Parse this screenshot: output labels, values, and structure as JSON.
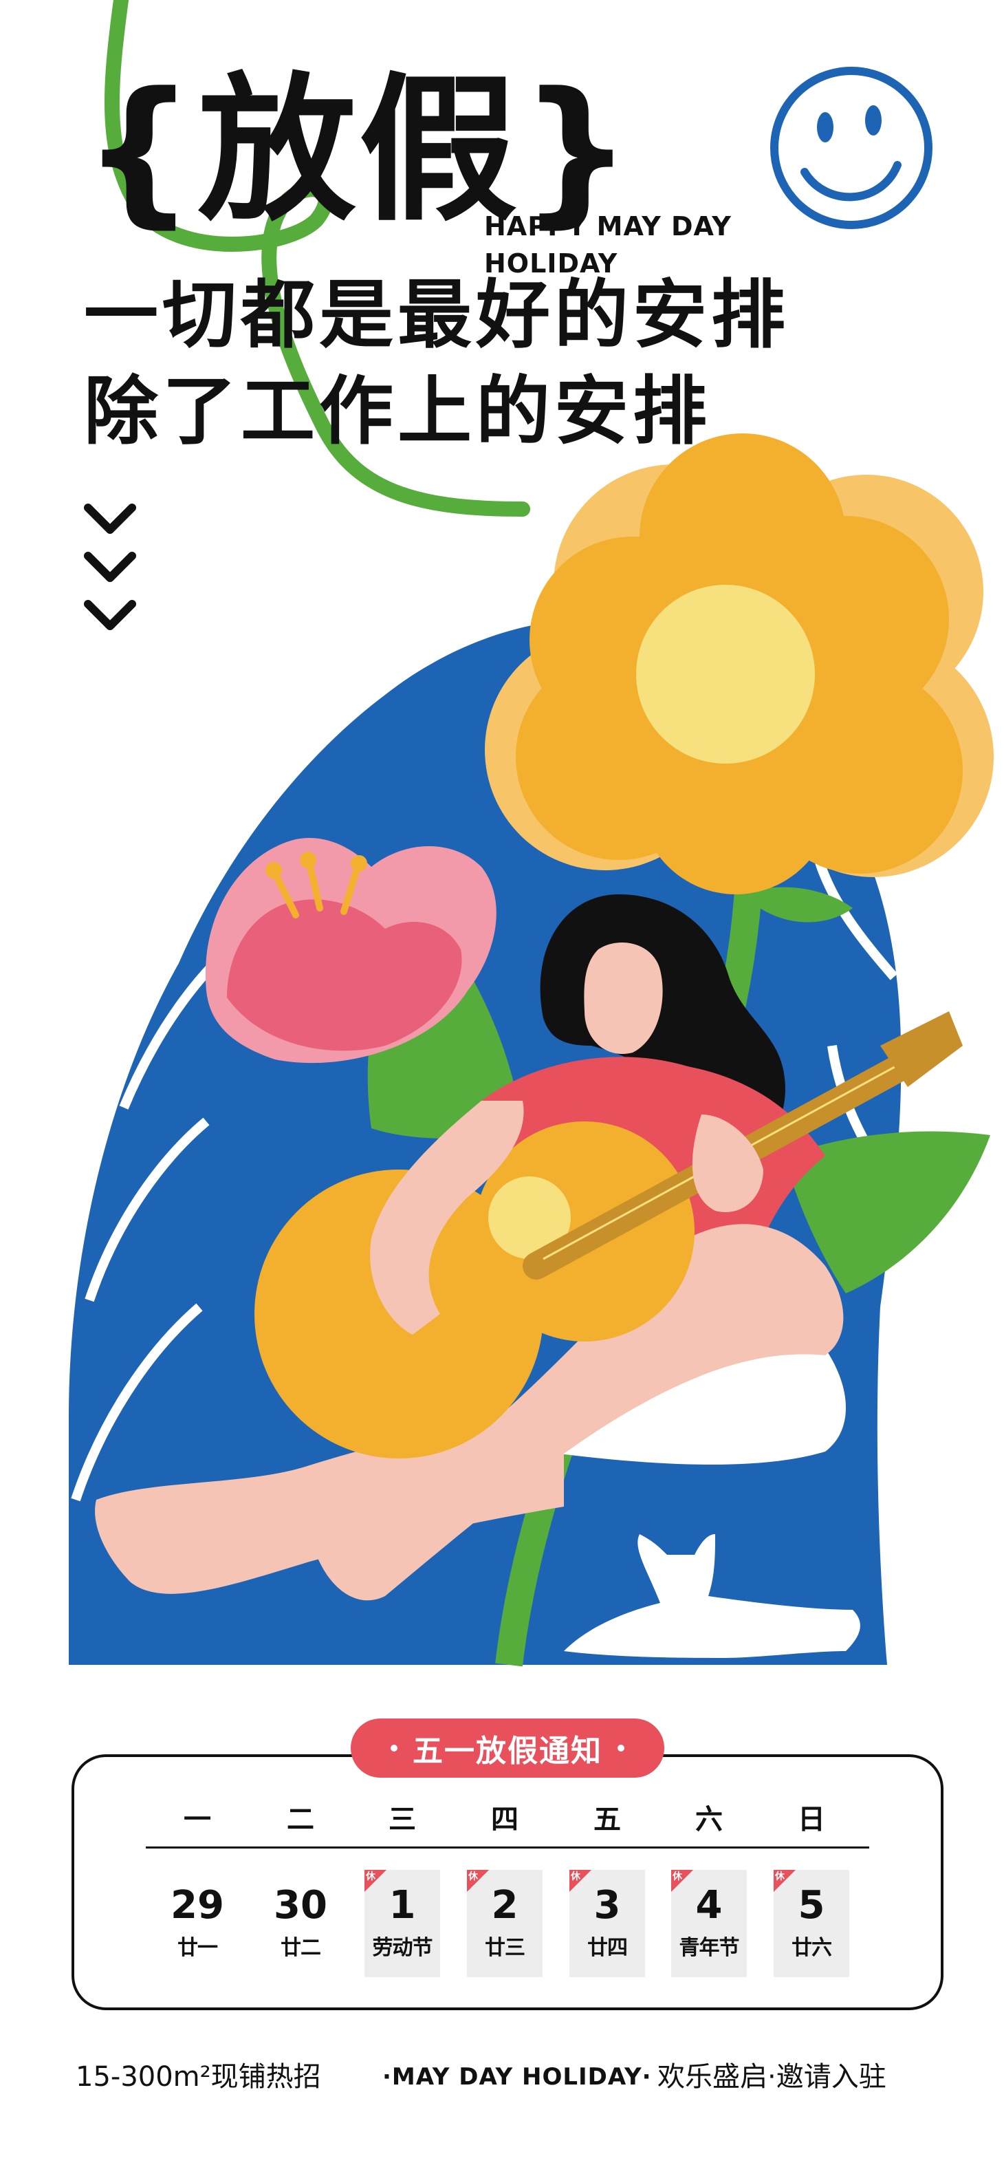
{
  "title": "{放假}",
  "subtitle_en_line1": "HAPPY MAY DAY",
  "subtitle_en_line2": "HOLIDAY",
  "slogan_line1": "一切都是最好的安排",
  "slogan_line2": "除了工作上的安排",
  "notice_label": "五一放假通知",
  "calendar": {
    "weekdays": [
      "一",
      "二",
      "三",
      "四",
      "五",
      "六",
      "日"
    ],
    "holiday_tag": "休",
    "days": [
      {
        "day": "29",
        "lunar": "廿一",
        "holiday": false
      },
      {
        "day": "30",
        "lunar": "廿二",
        "holiday": false
      },
      {
        "day": "1",
        "lunar": "劳动节",
        "holiday": true
      },
      {
        "day": "2",
        "lunar": "廿三",
        "holiday": true
      },
      {
        "day": "3",
        "lunar": "廿四",
        "holiday": true
      },
      {
        "day": "4",
        "lunar": "青年节",
        "holiday": true
      },
      {
        "day": "5",
        "lunar": "廿六",
        "holiday": true
      }
    ]
  },
  "footer": {
    "left": "15-300m²现铺热招",
    "middle": "·MAY DAY HOLIDAY·",
    "right": "欢乐盛启·邀请入驻"
  },
  "colors": {
    "blue": "#1e64b4",
    "yellow": "#f2b02e",
    "pink": "#e8505b",
    "green": "#56ad3c",
    "black": "#111111"
  }
}
